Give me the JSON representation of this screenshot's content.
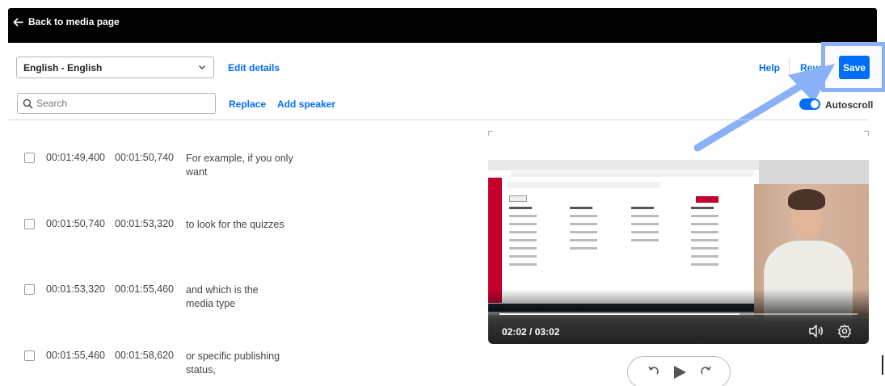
{
  "header": {
    "back_label": "Back to media page"
  },
  "toolbar": {
    "language_selected": "English - English",
    "edit_details_label": "Edit details",
    "search_placeholder": "Search",
    "replace_label": "Replace",
    "add_speaker_label": "Add speaker",
    "help_label": "Help",
    "revert_label": "Reve",
    "save_label": "Save",
    "autoscroll_label": "Autoscroll",
    "autoscroll_on": true
  },
  "captions": [
    {
      "start": "00:01:49,400",
      "end": "00:01:50,740",
      "text": "For example, if you only want"
    },
    {
      "start": "00:01:50,740",
      "end": "00:01:53,320",
      "text": "to look for the quizzes"
    },
    {
      "start": "00:01:53,320",
      "end": "00:01:55,460",
      "text": "and which is the media type"
    },
    {
      "start": "00:01:55,460",
      "end": "00:01:58,620",
      "text": "or specific publishing status,"
    }
  ],
  "player": {
    "time_display": "02:02 / 03:02",
    "progress_fraction": 0.67
  },
  "colors": {
    "accent": "#006efa",
    "header_bg": "#000000",
    "highlight": "#8ab0f5",
    "lms_brand": "#c4002c"
  },
  "icons": {
    "back": "arrow-left-icon",
    "dropdown": "chevron-down-icon",
    "search": "search-icon",
    "volume": "volume-icon",
    "settings": "gear-icon",
    "rewind": "rewind-icon",
    "play": "play-icon",
    "forward": "forward-icon"
  }
}
